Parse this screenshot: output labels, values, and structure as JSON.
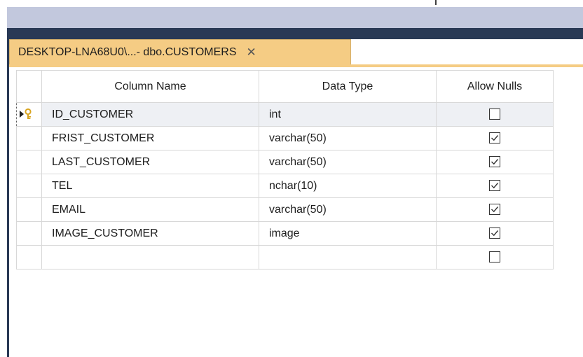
{
  "tab": {
    "title": "DESKTOP-LNA68U0\\...- dbo.CUSTOMERS",
    "close_glyph": "✕"
  },
  "grid": {
    "headers": {
      "column_name": "Column Name",
      "data_type": "Data Type",
      "allow_nulls": "Allow Nulls"
    },
    "rows": [
      {
        "name": "ID_CUSTOMER",
        "type": "int",
        "allow_nulls": false,
        "primary_key": true
      },
      {
        "name": "FRIST_CUSTOMER",
        "type": "varchar(50)",
        "allow_nulls": true
      },
      {
        "name": "LAST_CUSTOMER",
        "type": "varchar(50)",
        "allow_nulls": true
      },
      {
        "name": "TEL",
        "type": "nchar(10)",
        "allow_nulls": true
      },
      {
        "name": "EMAIL",
        "type": "varchar(50)",
        "allow_nulls": true
      },
      {
        "name": "IMAGE_CUSTOMER",
        "type": "image",
        "allow_nulls": true
      },
      {
        "name": "",
        "type": "",
        "allow_nulls": false
      }
    ]
  },
  "colors": {
    "title_band": "#c2c8dd",
    "navy": "#293955",
    "tab_active": "#f5cc84",
    "key_icon": "#d9a521"
  },
  "icons": {
    "row_indicator": "current-row-arrow-icon",
    "primary_key": "primary-key-icon",
    "close": "close-icon"
  }
}
